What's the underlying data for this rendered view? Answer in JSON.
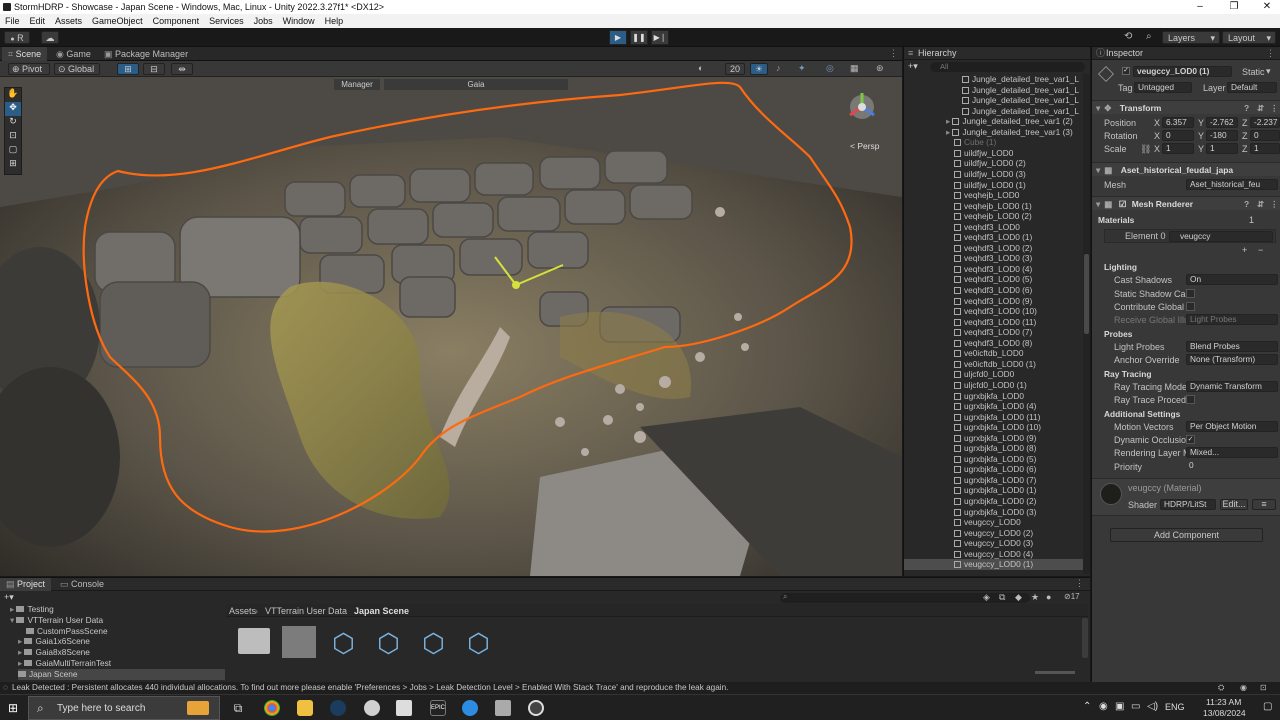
{
  "window": {
    "title": "StormHDRP - Showcase - Japan Scene - Windows, Mac, Linux - Unity 2022.3.27f1* <DX12>",
    "minimize": "–",
    "maximize": "❐",
    "close": "✕"
  },
  "menu": [
    "File",
    "Edit",
    "Assets",
    "GameObject",
    "Component",
    "Services",
    "Jobs",
    "Window",
    "Help"
  ],
  "toolbar": {
    "account_label": "R",
    "layers_label": "Layers",
    "layout_label": "Layout"
  },
  "scene_tabs": {
    "scene": "Scene",
    "game": "Game",
    "package_manager": "Package Manager"
  },
  "scene_tools": {
    "pivot": "Pivot",
    "global": "Global",
    "grid_size": "20"
  },
  "viewport": {
    "overlay_left": "Manager",
    "overlay_right": "Gaia",
    "persp_label": "< Persp"
  },
  "hierarchy": {
    "title": "Hierarchy",
    "search_placeholder": "All",
    "items": [
      "Jungle_detailed_tree_var1_L",
      "Jungle_detailed_tree_var1_L",
      "Jungle_detailed_tree_var1_L",
      "Jungle_detailed_tree_var1_L",
      "Jungle_detailed_tree_var1 (2)",
      "Jungle_detailed_tree_var1 (3)",
      "Cube (1)",
      "uildfjw_LOD0",
      "uildfjw_LOD0 (2)",
      "uildfjw_LOD0 (3)",
      "uildfjw_LOD0 (1)",
      "veqhejb_LOD0",
      "veqhejb_LOD0 (1)",
      "veqhejb_LOD0 (2)",
      "veqhdf3_LOD0",
      "veqhdf3_LOD0 (1)",
      "veqhdf3_LOD0 (2)",
      "veqhdf3_LOD0 (3)",
      "veqhdf3_LOD0 (4)",
      "veqhdf3_LOD0 (5)",
      "veqhdf3_LOD0 (6)",
      "veqhdf3_LOD0 (9)",
      "veqhdf3_LOD0 (10)",
      "veqhdf3_LOD0 (11)",
      "veqhdf3_LOD0 (7)",
      "veqhdf3_LOD0 (8)",
      "ve0icftdb_LOD0",
      "ve0icftdb_LOD0 (1)",
      "uljcfd0_LOD0",
      "uljcfd0_LOD0 (1)",
      "ugrxbjkfa_LOD0",
      "ugrxbjkfa_LOD0 (4)",
      "ugrxbjkfa_LOD0 (11)",
      "ugrxbjkfa_LOD0 (10)",
      "ugrxbjkfa_LOD0 (9)",
      "ugrxbjkfa_LOD0 (8)",
      "ugrxbjkfa_LOD0 (5)",
      "ugrxbjkfa_LOD0 (6)",
      "ugrxbjkfa_LOD0 (7)",
      "ugrxbjkfa_LOD0 (1)",
      "ugrxbjkfa_LOD0 (2)",
      "ugrxbjkfa_LOD0 (3)",
      "veugccy_LOD0",
      "veugccy_LOD0 (2)",
      "veugccy_LOD0 (3)",
      "veugccy_LOD0 (4)",
      "veugccy_LOD0 (1)"
    ]
  },
  "inspector": {
    "title": "Inspector",
    "object_name": "veugccy_LOD0 (1)",
    "static_label": "Static",
    "tag_label": "Tag",
    "tag_value": "Untagged",
    "layer_label": "Layer",
    "layer_value": "Default",
    "transform": {
      "title": "Transform",
      "position_label": "Position",
      "rotation_label": "Rotation",
      "scale_label": "Scale",
      "pos_x": "6.357",
      "pos_y": "-2.762",
      "pos_z": "-2.237",
      "rot_x": "0",
      "rot_y": "-180",
      "rot_z": "0",
      "scl_x": "1",
      "scl_y": "1",
      "scl_z": "1",
      "x": "X",
      "y": "Y",
      "z": "Z"
    },
    "mesh_filter": {
      "title": "Aset_historical_feudal_japa",
      "mesh_label": "Mesh",
      "mesh_value": "Aset_historical_feu"
    },
    "mesh_renderer": {
      "title": "Mesh Renderer",
      "materials_label": "Materials",
      "materials_count": "1",
      "element_label": "Element 0",
      "element_value": "veugccy",
      "lighting": "Lighting",
      "cast_shadows_label": "Cast Shadows",
      "cast_shadows_value": "On",
      "static_shadow_label": "Static Shadow Cas",
      "contribute_gi_label": "Contribute Global I",
      "receive_gi_label": "Receive Global Illu",
      "receive_gi_value": "Light Probes",
      "probes": "Probes",
      "light_probes_label": "Light Probes",
      "light_probes_value": "Blend Probes",
      "anchor_label": "Anchor Override",
      "anchor_value": "None (Transform)",
      "ray_tracing": "Ray Tracing",
      "rt_mode_label": "Ray Tracing Mode",
      "rt_mode_value": "Dynamic Transform",
      "rt_proc_label": "Ray Trace Procedu",
      "additional": "Additional Settings",
      "motion_label": "Motion Vectors",
      "motion_value": "Per Object Motion",
      "dyn_occl_label": "Dynamic Occlusio",
      "rendering_layer_label": "Rendering Layer M",
      "rendering_layer_value": "Mixed...",
      "priority_label": "Priority",
      "priority_value": "0"
    },
    "material": {
      "name": "veugccy (Material)",
      "shader_label": "Shader",
      "shader_value": "HDRP/LitSt",
      "edit_label": "Edit..."
    },
    "add_component": "Add Component"
  },
  "project": {
    "tab_project": "Project",
    "tab_console": "Console",
    "tree": [
      "Testing",
      "VTTerrain User Data",
      "CustomPassScene",
      "Gaia1x6Scene",
      "Gaia8x8Scene",
      "GaiaMultiTerrainTest",
      "Japan Scene"
    ],
    "breadcrumb": [
      "Assets",
      "VTTerrain User Data",
      "Japan Scene"
    ],
    "count_badge": "17"
  },
  "status": {
    "message": "Leak Detected : Persistent allocates 440 individual allocations. To find out more please enable 'Preferences > Jobs > Leak Detection Level > Enabled With Stack Trace' and reproduce the leak again."
  },
  "taskbar": {
    "search_placeholder": "Type here to search",
    "lang": "ENG",
    "time": "11:23 AM",
    "date": "13/08/2024"
  },
  "colors": {
    "selection_outline": "#ff6a10",
    "accent": "#2c5d87"
  }
}
